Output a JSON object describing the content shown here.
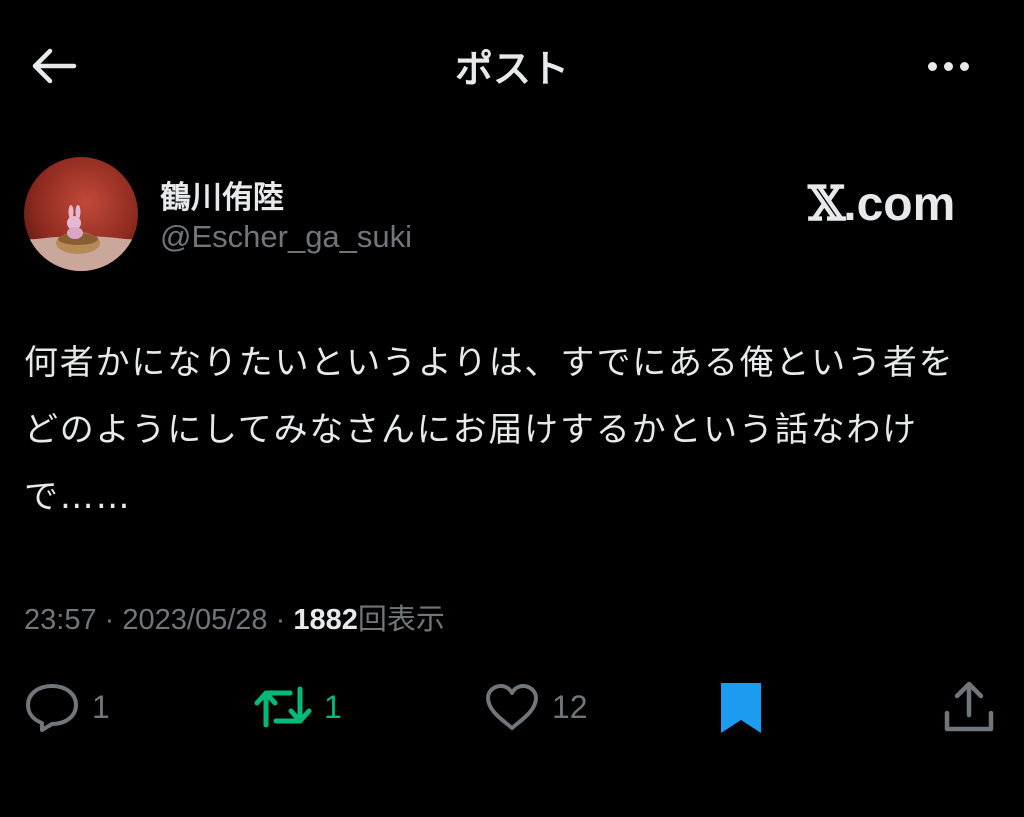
{
  "header": {
    "title": "ポスト",
    "back_icon": "arrow-left-icon",
    "more_icon": "more-horizontal-icon"
  },
  "author": {
    "display_name": "鶴川侑陸",
    "handle": "@Escher_ga_suki"
  },
  "watermark": {
    "x": "𝕏",
    "rest": ".com"
  },
  "post": {
    "text": "何者かになりたいというよりは、すでにある俺という者をどのようにしてみなさんにお届けするかという話なわけで……"
  },
  "meta": {
    "time": "23:57",
    "separator": "·",
    "date": "2023/05/28",
    "views_count": "1882",
    "views_label": "回表示"
  },
  "actions": {
    "reply_count": "1",
    "retweet_count": "1",
    "like_count": "12"
  },
  "colors": {
    "background": "#000000",
    "text": "#e7e9ea",
    "secondary": "#71767b",
    "retweet_green": "#00ba7c",
    "bookmark_blue": "#1d9bf0"
  }
}
